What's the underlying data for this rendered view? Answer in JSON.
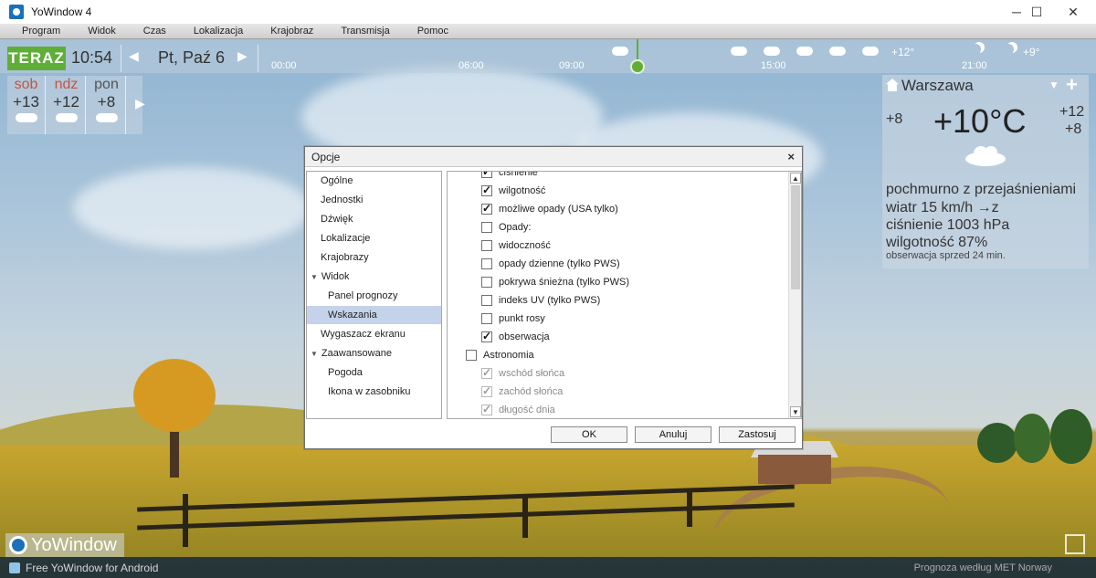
{
  "window": {
    "title": "YoWindow 4",
    "minimize": "─",
    "maximize": "☐",
    "close": "✕"
  },
  "menu": [
    "Program",
    "Widok",
    "Czas",
    "Lokalizacja",
    "Krajobraz",
    "Transmisja",
    "Pomoc"
  ],
  "timeline": {
    "now_label": "TERAZ",
    "time": "10:54",
    "date": "Pt, Paź 6",
    "hours": [
      "00:00",
      "06:00",
      "09:00",
      "15:00",
      "21:00"
    ],
    "temps": [
      "+12°",
      "+9°"
    ]
  },
  "forecast": [
    {
      "day": "sob",
      "temp": "+13"
    },
    {
      "day": "ndz",
      "temp": "+12"
    },
    {
      "day": "pon",
      "temp": "+8"
    }
  ],
  "weather": {
    "city": "Warszawa",
    "feels_like": "+8",
    "temp": "+10°C",
    "high": "+12",
    "low": "+8",
    "condition": "pochmurno z przejaśnieniami",
    "wind": "wiatr  15 km/h  →z",
    "pressure": "ciśnienie  1003 hPa",
    "humidity": "wilgotność  87%",
    "observation": "obserwacja sprzed 24 min."
  },
  "bottom": {
    "logo": "YoWindow",
    "android": "Free YoWindow for Android",
    "credit": "Prognoza według MET Norway"
  },
  "dialog": {
    "title": "Opcje",
    "close": "×",
    "nav": [
      "Ogólne",
      "Jednostki",
      "Dźwięk",
      "Lokalizacje",
      "Krajobrazy",
      "Widok",
      "Panel prognozy",
      "Wskazania",
      "Wygaszacz ekranu",
      "Zaawansowane",
      "Pogoda",
      "Ikona w zasobniku"
    ],
    "options": [
      {
        "label": "ciśnienie",
        "checked": true,
        "disabled": false
      },
      {
        "label": "wilgotność",
        "checked": true,
        "disabled": false
      },
      {
        "label": "możliwe opady (USA tylko)",
        "checked": true,
        "disabled": false
      },
      {
        "label": "Opady:",
        "checked": false,
        "disabled": false
      },
      {
        "label": "widoczność",
        "checked": false,
        "disabled": false
      },
      {
        "label": "opady dzienne (tylko PWS)",
        "checked": false,
        "disabled": false
      },
      {
        "label": "pokrywa śnieżna (tylko PWS)",
        "checked": false,
        "disabled": false
      },
      {
        "label": "indeks UV (tylko PWS)",
        "checked": false,
        "disabled": false
      },
      {
        "label": "punkt rosy",
        "checked": false,
        "disabled": false
      },
      {
        "label": "obserwacja",
        "checked": true,
        "disabled": false
      },
      {
        "label": "Astronomia",
        "checked": false,
        "disabled": false
      },
      {
        "label": "wschód słońca",
        "checked": true,
        "disabled": true
      },
      {
        "label": "zachód słońca",
        "checked": true,
        "disabled": true
      },
      {
        "label": "długość dnia",
        "checked": true,
        "disabled": true
      }
    ],
    "buttons": {
      "ok": "OK",
      "cancel": "Anuluj",
      "apply": "Zastosuj"
    }
  }
}
